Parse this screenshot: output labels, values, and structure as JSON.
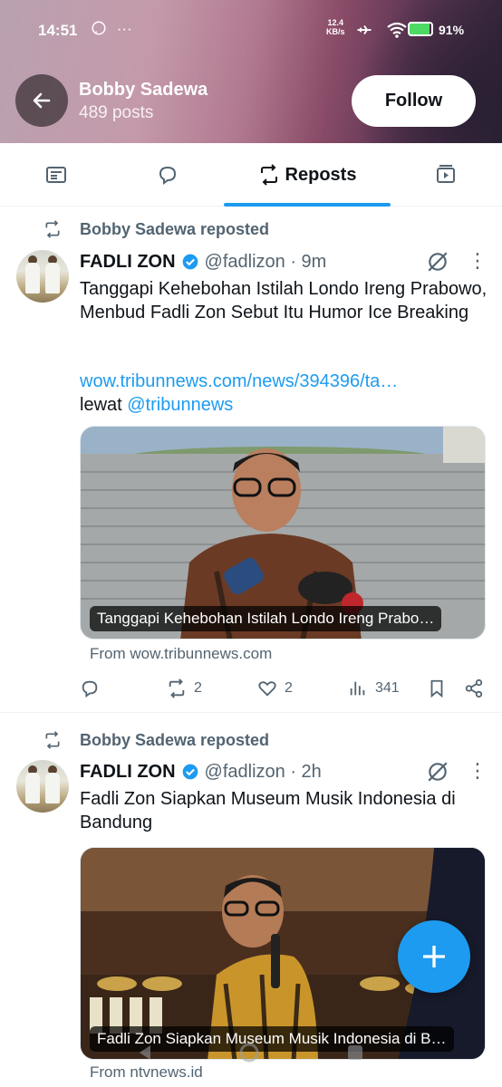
{
  "status_bar": {
    "time": "14:51",
    "speed_value": "12.4",
    "speed_unit": "KB/s",
    "battery_percent": "91%",
    "battery_level": 0.91
  },
  "header": {
    "profile_name": "Bobby Sadewa",
    "posts_count": "489 posts",
    "follow_label": "Follow"
  },
  "tabs": [
    {
      "icon": "article-icon",
      "label": ""
    },
    {
      "icon": "comment-icon",
      "label": ""
    },
    {
      "icon": "repost-icon",
      "label": "Reposts",
      "active": true
    },
    {
      "icon": "video-icon",
      "label": ""
    }
  ],
  "posts": [
    {
      "repost_by": "Bobby Sadewa reposted",
      "author_name": "FADLI ZON",
      "handle_time": "@fadlizon · 9m",
      "text": "Tanggapi Kehebohan Istilah Londo Ireng Prabowo, Menbud Fadli Zon Sebut Itu Humor Ice Breaking",
      "link": "wow.tribunnews.com/news/394396/ta…",
      "via_prefix": "lewat ",
      "via_handle": "@tribunnews",
      "media_caption": "Tanggapi Kehebohan Istilah Londo Ireng Prabo…",
      "from": "From wow.tribunnews.com",
      "replies": "",
      "reposts": "2",
      "likes": "2",
      "views": "341"
    },
    {
      "repost_by": "Bobby Sadewa reposted",
      "author_name": "FADLI ZON",
      "handle_time": "@fadlizon · 2h",
      "text": "Fadli Zon Siapkan Museum Musik Indonesia di Bandung",
      "media_caption": "Fadli Zon Siapkan Museum Musik Indonesia di B…",
      "from": "From ntvnews.id"
    }
  ],
  "colors": {
    "accent": "#1d9bf0",
    "secondary_text": "#536471",
    "primary_text": "#0f1419"
  }
}
